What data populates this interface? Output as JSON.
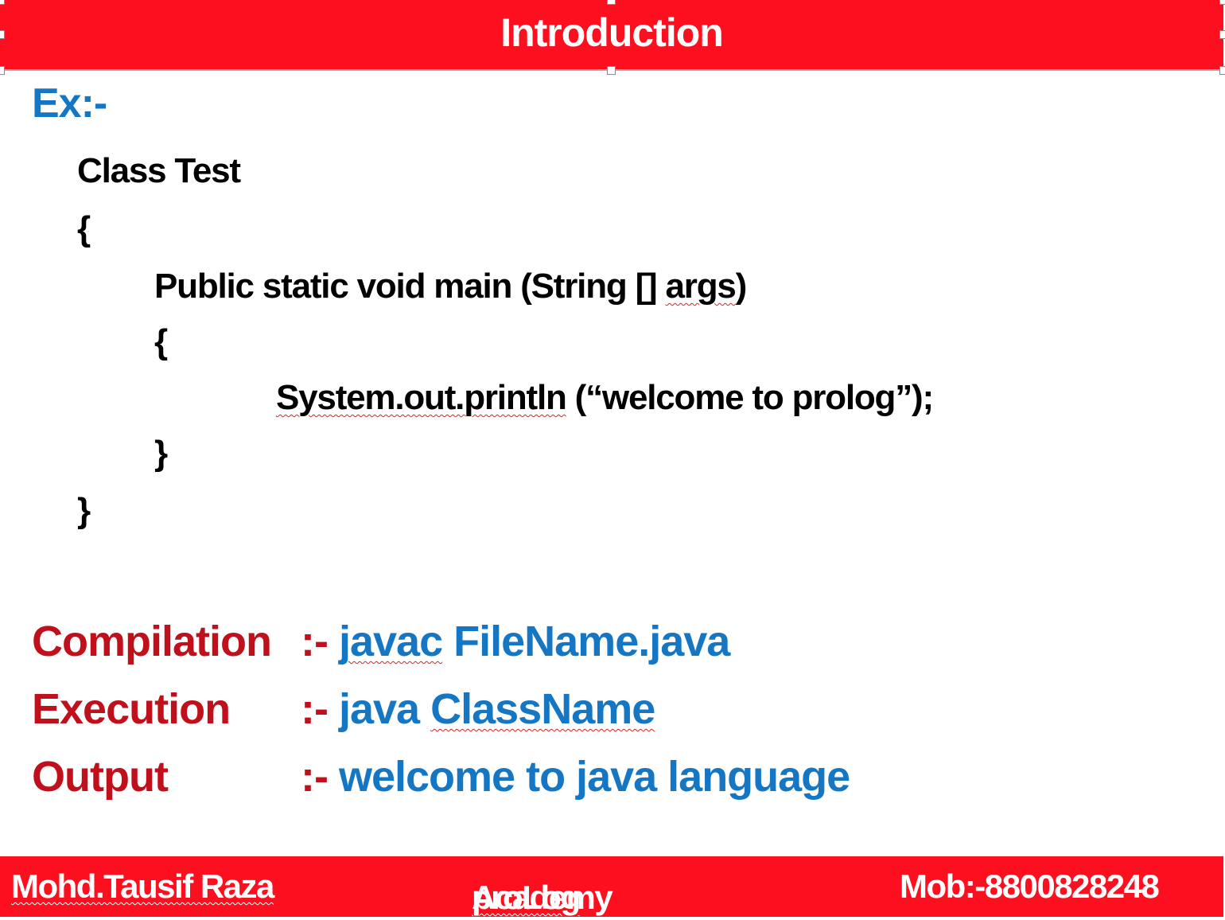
{
  "header": {
    "title": "Introduction",
    "color": "#fc0f1e"
  },
  "example_label": "Ex:-",
  "code": {
    "line1": "Class Test",
    "line2": "{",
    "line3_a": "Public static void main (String [] ",
    "line3_b": "args",
    "line3_c": ")",
    "line4": "{",
    "line5_a": "System.out.println",
    "line5_b": " (“welcome to prolog”);",
    "line6": "}",
    "line7": "}"
  },
  "commands": [
    {
      "label": "Compilation",
      "sep": ":-",
      "value_a": "javac",
      "value_b": " FileName.java"
    },
    {
      "label": "Execution",
      "sep": ":-",
      "value_a": "java ",
      "value_b": "ClassName"
    },
    {
      "label": "Output",
      "sep": ":-",
      "value_a": "welcome to java language"
    }
  ],
  "footer": {
    "author": "Mohd.Tausif Raza",
    "academy_a": "proLog",
    "academy_b": " Academy",
    "mobile": "Mob:-8800828248"
  },
  "colors": {
    "blue": "#1577c4",
    "dark_red": "#c0101c"
  }
}
